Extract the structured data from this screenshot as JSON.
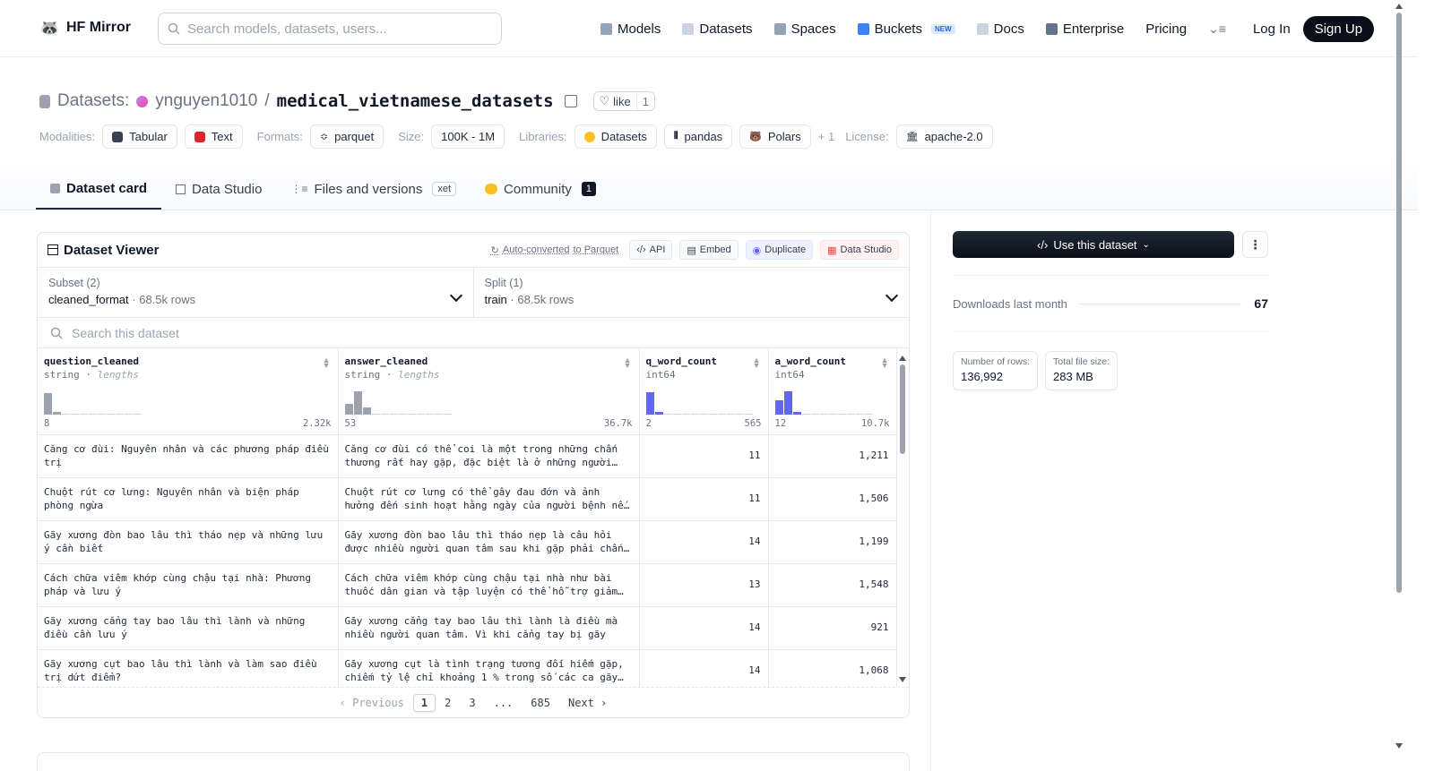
{
  "header": {
    "logo_text": "HF Mirror",
    "search_placeholder": "Search models, datasets, users...",
    "nav": [
      {
        "label": "Models",
        "color": "#94a3b8"
      },
      {
        "label": "Datasets",
        "color": "#cbd5e1"
      },
      {
        "label": "Spaces",
        "color": "#94a3b8"
      },
      {
        "label": "Buckets",
        "color": "#3b82f6"
      },
      {
        "label": "Docs",
        "color": "#cbd5e1"
      },
      {
        "label": "Enterprise",
        "color": "#64748b"
      },
      {
        "label": "Pricing"
      }
    ],
    "buckets_badge": "NEW",
    "login": "Log In",
    "signup": "Sign Up"
  },
  "repo": {
    "prefix": "Datasets:",
    "owner": "ynguyen1010",
    "separator": "/",
    "name": "medical_vietnamese_datasets",
    "like_label": "like",
    "like_count": "1"
  },
  "meta": {
    "modalities_label": "Modalities:",
    "modalities": [
      "Tabular",
      "Text"
    ],
    "formats_label": "Formats:",
    "format": "parquet",
    "size_label": "Size:",
    "size": "100K - 1M",
    "libraries_label": "Libraries:",
    "libraries": [
      "Datasets",
      "pandas",
      "Polars"
    ],
    "libraries_more": "+ 1",
    "license_label": "License:",
    "license": "apache-2.0"
  },
  "tabs": {
    "dataset_card": "Dataset card",
    "data_studio": "Data Studio",
    "files": "Files and versions",
    "xet": "xet",
    "community": "Community",
    "community_count": "1"
  },
  "viewer": {
    "title": "Dataset Viewer",
    "auto_converted": "Auto-converted",
    "auto_converted_suffix": "to Parquet",
    "api": "API",
    "embed": "Embed",
    "duplicate": "Duplicate",
    "data_studio": "Data Studio",
    "subset_label": "Subset (2)",
    "subset_value": "cleaned_format",
    "subset_rows": "68.5k rows",
    "split_label": "Split (1)",
    "split_value": "train",
    "split_rows": "68.5k rows",
    "dot": "·",
    "search_placeholder": "Search this dataset",
    "columns": [
      {
        "name": "question_cleaned",
        "type": "string",
        "sub": "lengths",
        "min": "8",
        "max": "2.32k",
        "hist": [
          0.92,
          0.12,
          0.06,
          0.06,
          0.06,
          0.06,
          0.06,
          0.06,
          0.06,
          0.06,
          0.06
        ],
        "color": "#9ca3af"
      },
      {
        "name": "answer_cleaned",
        "type": "string",
        "sub": "lengths",
        "min": "53",
        "max": "36.7k",
        "hist": [
          0.45,
          1.0,
          0.3,
          0.06,
          0.06,
          0.06,
          0.06,
          0.06,
          0.06,
          0.06,
          0.06,
          0.06
        ],
        "color": "#9ca3af"
      },
      {
        "name": "q_word_count",
        "type": "int64",
        "sub": "",
        "min": "2",
        "max": "565",
        "hist": [
          0.95,
          0.12,
          0.06,
          0.06,
          0.06,
          0.06,
          0.06,
          0.06,
          0.06,
          0.06,
          0.06,
          0.06
        ],
        "color": "#6366f1"
      },
      {
        "name": "a_word_count",
        "type": "int64",
        "sub": "",
        "min": "12",
        "max": "10.7k",
        "hist": [
          0.6,
          1.0,
          0.12,
          0.06,
          0.06,
          0.06,
          0.06,
          0.06,
          0.06,
          0.06,
          0.06
        ],
        "color": "#6366f1"
      }
    ],
    "rows": [
      {
        "q": "Căng cơ đùi: Nguyên nhân và các phương pháp điều trị",
        "a": "Căng cơ đùi có thể coi là một trong những chấn thương rất hay gặp, đặc biệt là ở những người chơi thể thao",
        "qc": "11",
        "ac": "1,211"
      },
      {
        "q": "Chuột rút cơ lưng: Nguyên nhân và biện pháp phòng ngừa",
        "a": "Chuột rút cơ lưng có thể gây đau đớn và ảnh hưởng đến sinh hoạt hằng ngày của người bệnh nếu không",
        "qc": "11",
        "ac": "1,506"
      },
      {
        "q": "Gãy xương đòn bao lâu thì tháo nẹp và những lưu ý cần biết",
        "a": "Gãy xương đòn bao lâu thì tháo nẹp là câu hỏi được nhiều người quan tâm sau khi gặp phải chấn thương",
        "qc": "14",
        "ac": "1,199"
      },
      {
        "q": "Cách chữa viêm khớp cùng chậu tại nhà: Phương pháp và lưu ý",
        "a": "Cách chữa viêm khớp cùng chậu tại nhà như bài thuốc dân gian và tập luyện có thể hỗ trợ giảm đau",
        "qc": "13",
        "ac": "1,548"
      },
      {
        "q": "Gãy xương cẳng tay bao lâu thì lành và những điều cần lưu ý",
        "a": "Gãy xương cẳng tay bao lâu thì lành là điều mà nhiều người quan tâm. Vì khi cẳng tay bị gãy",
        "qc": "14",
        "ac": "921"
      },
      {
        "q": "Gãy xương cụt bao lâu thì lành và làm sao điều trị dứt điểm?",
        "a": "Gãy xương cụt là tình trạng tương đối hiếm gặp, chiếm tỷ lệ chỉ khoảng 1 % trong số các ca gãy xương",
        "qc": "14",
        "ac": "1,068"
      }
    ],
    "pager": {
      "prev": "Previous",
      "pages": [
        "1",
        "2",
        "3",
        "...",
        "685"
      ],
      "next": "Next",
      "current": "1"
    }
  },
  "sidebar": {
    "use_dataset": "Use this dataset",
    "downloads_label": "Downloads last month",
    "downloads_value": "67",
    "rows_label": "Number of rows:",
    "rows_value": "136,992",
    "size_label": "Total file size:",
    "size_value": "283 MB"
  }
}
